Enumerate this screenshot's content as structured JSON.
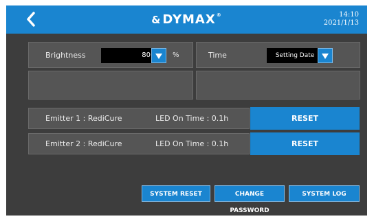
{
  "header": {
    "brand": "DYMAX",
    "brand_prefix": "&",
    "time": "14:10",
    "date": "2021/1/13"
  },
  "settings": {
    "brightness_label": "Brightness",
    "brightness_value": "80",
    "brightness_unit": "%",
    "time_label": "Time",
    "time_value": "Setting Date"
  },
  "emitters": [
    {
      "label": "Emitter 1 : RediCure",
      "led": "LED On Time : 0.1h",
      "button": "RESET"
    },
    {
      "label": "Emitter 2 : RediCure",
      "led": "LED On Time : 0.1h",
      "button": "RESET"
    }
  ],
  "actions": {
    "system_reset": "SYSTEM RESET",
    "change_password": "CHANGE PASSWORD",
    "system_log": "SYSTEM LOG"
  },
  "colors": {
    "accent": "#1a85d0",
    "background": "#3d3d3d",
    "panel": "#555555"
  }
}
